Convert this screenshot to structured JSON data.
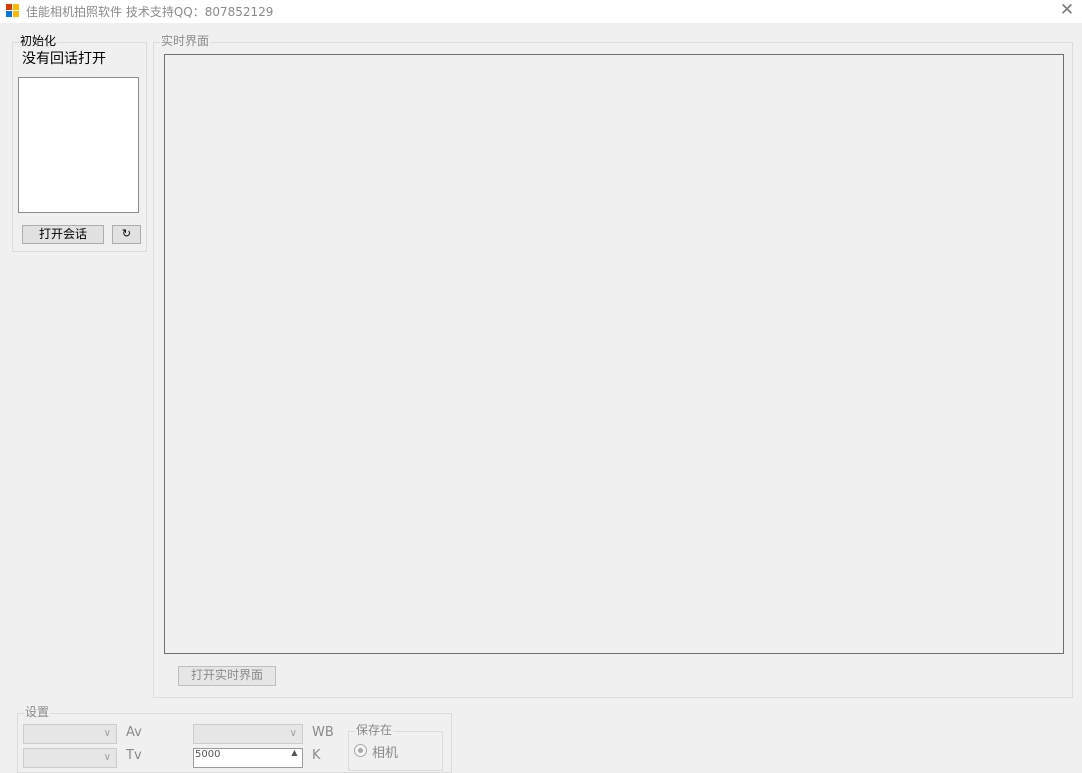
{
  "window": {
    "title": "佳能相机拍照软件 技术支持QQ：807852129",
    "close_glyph": "✕"
  },
  "init_panel": {
    "legend": "初始化",
    "session_status": "没有回话打开",
    "open_session_label": "打开会话",
    "refresh_label": "↻"
  },
  "live_panel": {
    "legend": "实时界面",
    "open_live_label": "打开实时界面"
  },
  "settings_panel": {
    "legend": "设置",
    "av_label": "Av",
    "wb_label": "WB",
    "tv_label": "Tv",
    "k_value": "5000",
    "k_label": "K",
    "save_legend": "保存在",
    "save_option_camera": "相机"
  },
  "colors": {
    "window_bg": "#f0f0f0",
    "disabled_text": "#8a8a8a"
  }
}
